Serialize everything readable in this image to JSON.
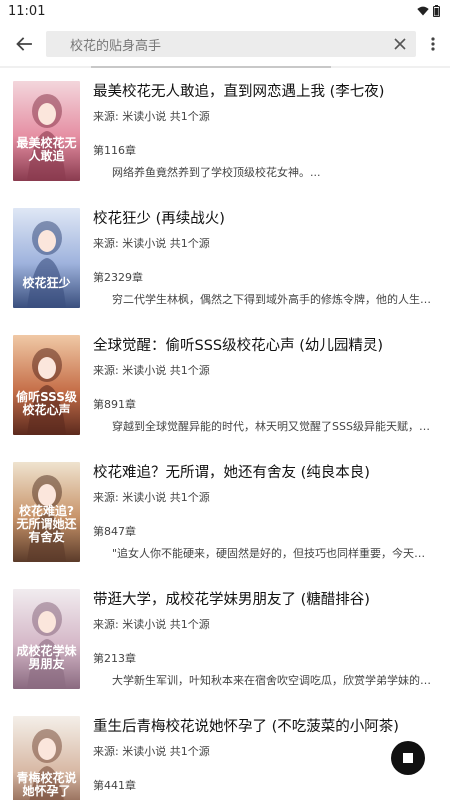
{
  "status_bar": {
    "time": "11:01"
  },
  "search": {
    "query": "校花的贴身高手"
  },
  "books": [
    {
      "title": "最美校花无人敢追，直到网恋遇上我 (李七夜)",
      "source": "来源: 米读小说 共1个源",
      "chapter": "第116章",
      "description": "网络养鱼竟然养到了学校顶级校花女神。...",
      "cover_text": "最美校花无人敢追",
      "cover_colors": [
        "#f3d6dc",
        "#e58fa3",
        "#8a3b4f"
      ]
    },
    {
      "title": "校花狂少 (再续战火)",
      "source": "来源: 米读小说 共1个源",
      "chapter": "第2329章",
      "description": "穷二代学生林枫，偶然之下得到域外高手的修炼令牌，他的人生轨迹因...",
      "cover_text": "校花狂少",
      "cover_colors": [
        "#dfe7f5",
        "#9fb3dd",
        "#3a4f7e"
      ]
    },
    {
      "title": "全球觉醒：偷听SSS级校花心声 (幼儿园精灵)",
      "source": "来源: 米读小说 共1个源",
      "chapter": "第891章",
      "description": "穿越到全球觉醒异能的时代，林天明又觉醒了SSS级异能天赋，本以为...",
      "cover_text": "偷听SSS级校花心声",
      "cover_colors": [
        "#f0c9a6",
        "#c6704a",
        "#5c2a1e"
      ]
    },
    {
      "title": "校花难追？无所谓，她还有舍友 (纯良本良)",
      "source": "来源: 米读小说 共1个源",
      "chapter": "第847章",
      "description": "\"追女人你不能硬来，硬固然是好的，但技巧也同样重要，今天我们就来...",
      "cover_text": "校花难追?无所谓她还有舍友",
      "cover_colors": [
        "#efe3cf",
        "#c8946a",
        "#5b3b2a"
      ]
    },
    {
      "title": "带逛大学，成校花学妹男朋友了 (糖醋排谷)",
      "source": "来源: 米读小说 共1个源",
      "chapter": "第213章",
      "description": "大学新生军训，叶知秋本来在宿舍吹空调吃瓜，欣赏学弟学妹的军姿，...",
      "cover_text": "成校花学妹男朋友",
      "cover_colors": [
        "#f1ecef",
        "#d5b8c8",
        "#8a6a80"
      ]
    },
    {
      "title": "重生后青梅校花说她怀孕了 (不吃菠菜的小阿茶)",
      "source": "来源: 米读小说 共1个源",
      "chapter": "第441章",
      "description": "",
      "cover_text": "青梅校花说她怀孕了",
      "cover_colors": [
        "#f4efe9",
        "#d8b9a5",
        "#7a4f3c"
      ]
    }
  ]
}
